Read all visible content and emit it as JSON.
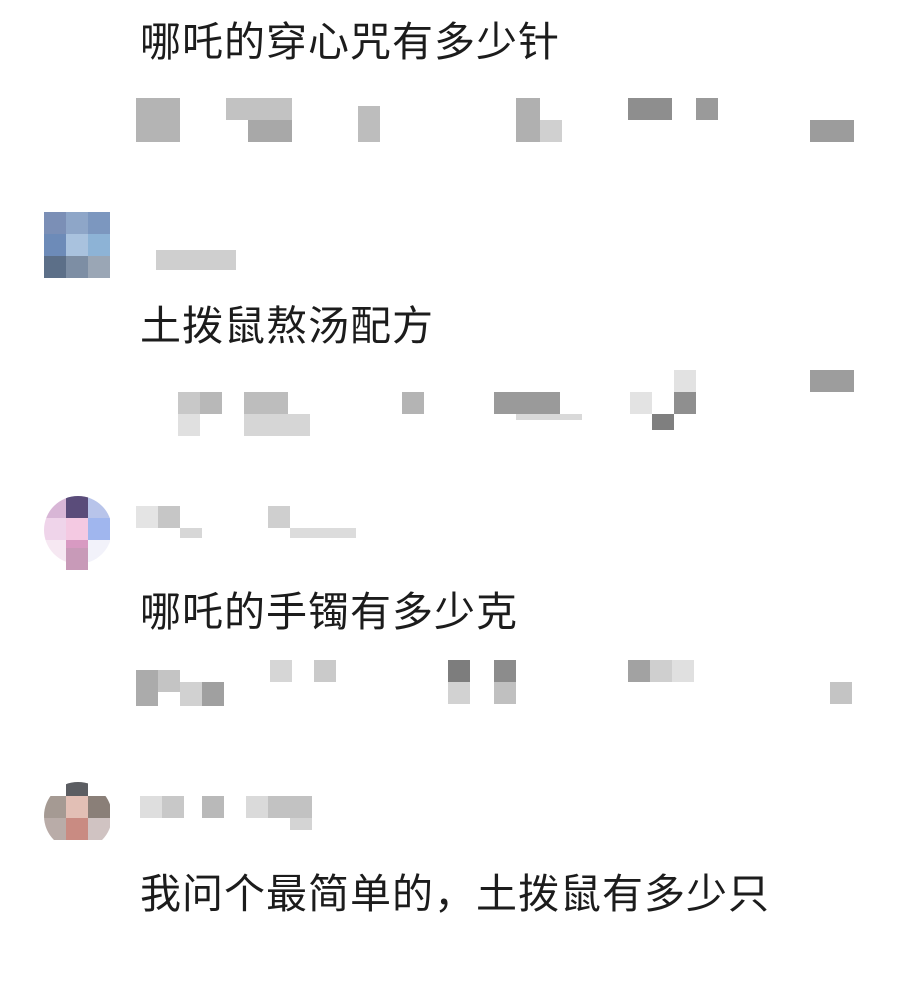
{
  "comments": [
    {
      "text": "哪吒的穿心咒有多少针"
    },
    {
      "text": "土拨鼠熬汤配方"
    },
    {
      "text": "哪吒的手镯有多少克"
    },
    {
      "text": "我问个最简单的，土拨鼠有多少只"
    }
  ],
  "colors": {
    "text": "#1c1c1c",
    "background": "#ffffff",
    "mosaic_dark": "#8a8a8a",
    "mosaic_light": "#d4d4d4"
  }
}
